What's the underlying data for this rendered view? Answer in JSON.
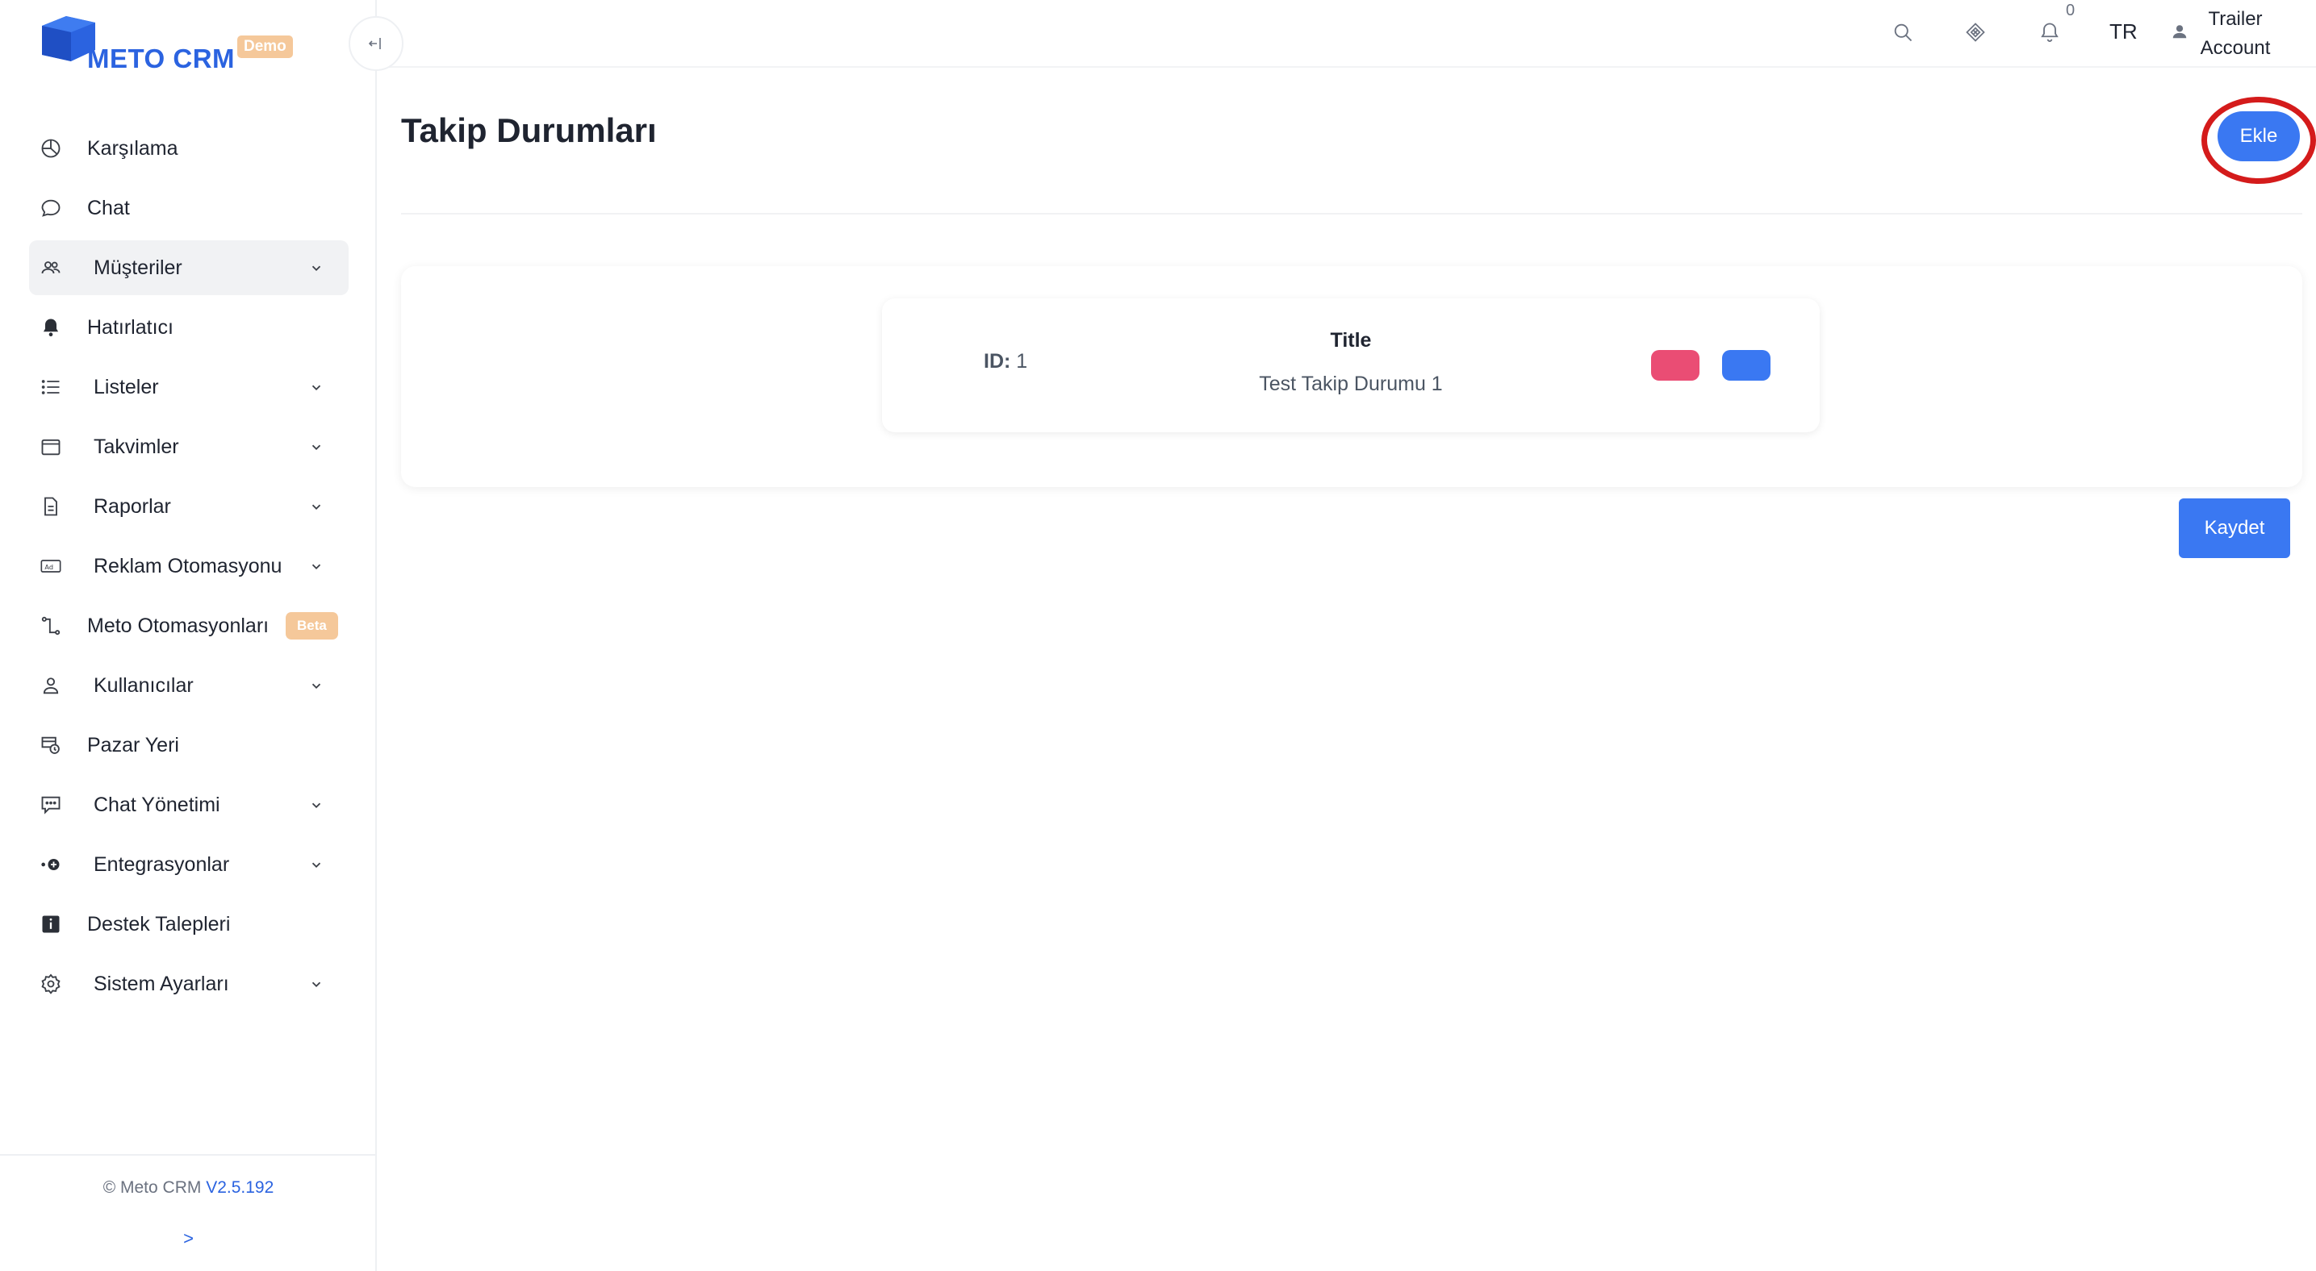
{
  "brand": {
    "name": "METO CRM",
    "badge": "Demo",
    "color": "#2b63e0"
  },
  "sidebar": {
    "collapse_icon": "collapse-left-icon",
    "items": [
      {
        "label": "Karşılama",
        "icon": "chart-pie-icon",
        "chevron": false
      },
      {
        "label": "Chat",
        "icon": "chat-bubble-icon",
        "chevron": false
      },
      {
        "label": "Müşteriler",
        "icon": "users-icon",
        "chevron": true,
        "active": true
      },
      {
        "label": "Hatırlatıcı",
        "icon": "bell-icon",
        "chevron": false
      },
      {
        "label": "Listeler",
        "icon": "list-icon",
        "chevron": true
      },
      {
        "label": "Takvimler",
        "icon": "calendar-icon",
        "chevron": true
      },
      {
        "label": "Raporlar",
        "icon": "document-icon",
        "chevron": true
      },
      {
        "label": "Reklam Otomasyonu",
        "icon": "ad-icon",
        "chevron": true
      },
      {
        "label": "Meto Otomasyonları",
        "icon": "flow-icon",
        "chevron": false,
        "badge": "Beta"
      },
      {
        "label": "Kullanıcılar",
        "icon": "user-icon",
        "chevron": true
      },
      {
        "label": "Pazar Yeri",
        "icon": "marketplace-icon",
        "chevron": false
      },
      {
        "label": "Chat Yönetimi",
        "icon": "chat-settings-icon",
        "chevron": true
      },
      {
        "label": "Entegrasyonlar",
        "icon": "integration-icon",
        "chevron": true
      },
      {
        "label": "Destek Talepleri",
        "icon": "info-icon",
        "chevron": false
      },
      {
        "label": "Sistem Ayarları",
        "icon": "gear-icon",
        "chevron": true
      }
    ],
    "footer": {
      "copyright": "© Meto CRM ",
      "version": "V2.5.192",
      "expand": ">"
    }
  },
  "topbar": {
    "search_icon": "search-icon",
    "apps_icon": "diamond-icon",
    "notification_icon": "bell-outline-icon",
    "notification_count": "0",
    "language": "TR",
    "user_line1": "Trailer",
    "user_line2": "Account"
  },
  "page": {
    "title": "Takip Durumları",
    "add_button": "Ekle",
    "save_button": "Kaydet"
  },
  "status_items": [
    {
      "id_label": "ID:",
      "id_value": "1",
      "title_header": "Title",
      "title_value": "Test Takip Durumu 1",
      "delete_color": "#ea4d74",
      "edit_color": "#3a78f2"
    }
  ],
  "colors": {
    "primary": "#3a78f2",
    "danger": "#ea4d74",
    "highlight": "#d41b1b",
    "beta_badge": "#f5c89a"
  }
}
